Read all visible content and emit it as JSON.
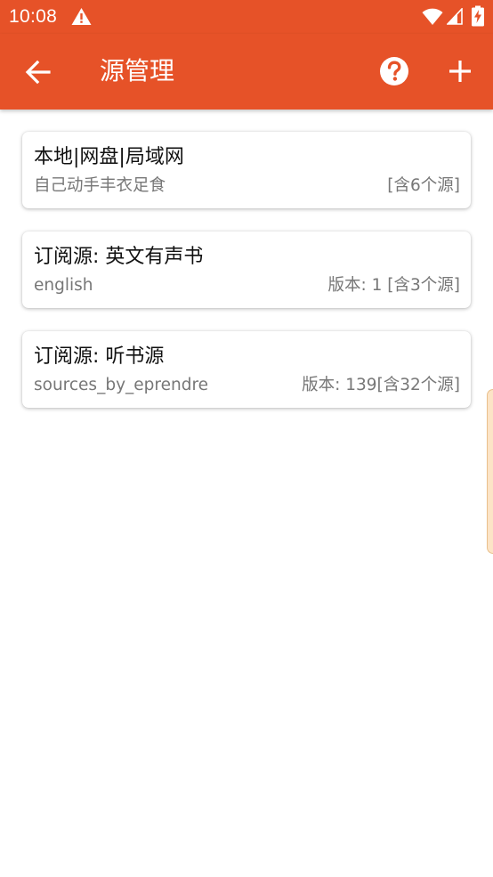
{
  "status_bar": {
    "time": "10:08",
    "icons": [
      "warning-icon",
      "wifi-icon",
      "cell-signal-icon",
      "battery-charging-icon"
    ]
  },
  "toolbar": {
    "title": "源管理",
    "back_icon": "arrow-left-icon",
    "help_icon": "help-circle-icon",
    "add_icon": "plus-icon"
  },
  "sources": [
    {
      "title": "本地|网盘|局域网",
      "subtitle": "自己动手丰衣足食",
      "meta": "[含6个源]"
    },
    {
      "title": "订阅源: 英文有声书",
      "subtitle": "english",
      "meta": "版本: 1 [含3个源]"
    },
    {
      "title": "订阅源: 听书源",
      "subtitle": "sources_by_eprendre",
      "meta": "版本: 139[含32个源]"
    }
  ],
  "colors": {
    "brand": "#E65228",
    "card_bg": "#FFFFFF",
    "title_text": "#111111",
    "secondary_text": "#777777",
    "scroll_handle": "#FCE4C6"
  }
}
